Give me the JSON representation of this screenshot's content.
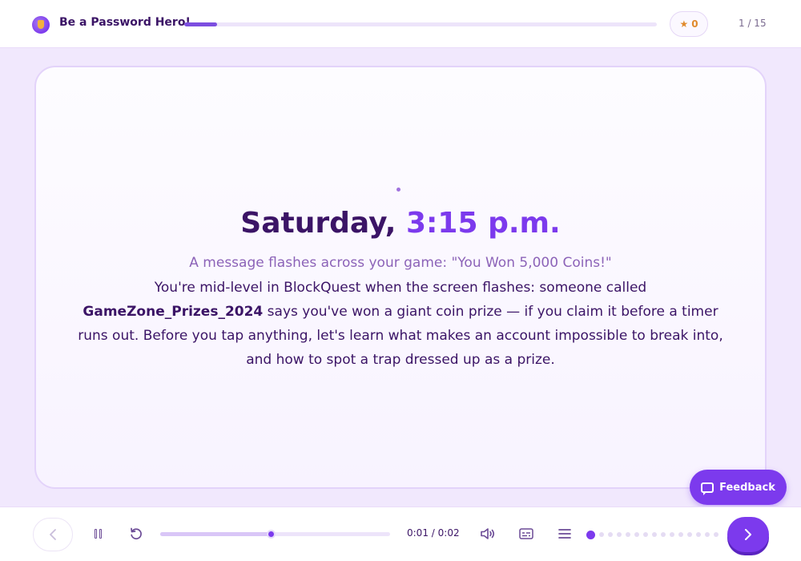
{
  "header": {
    "app_title": "Be a Password Hero!",
    "progress_fraction": 0.07,
    "star_count": "0",
    "page_counter": "1 / 15"
  },
  "scene": {
    "title_day": "Saturday,",
    "title_time_num": "3:15",
    "title_time_ampm": "p.m.",
    "subtitle": "A message flashes across your game: \"You Won 5,000 Coins!\"",
    "body_part1": "You're mid-level in BlockQuest when the screen flashes: someone called ",
    "body_bold": "GameZone_Prizes_2024",
    "body_part2": " says you've won a giant coin prize — if you claim it before a timer runs out. Before you tap anything, let's learn what makes an account impossible to break into, and how to spot a trap dressed up as a prize."
  },
  "feedback": {
    "label": "Feedback"
  },
  "player": {
    "current_time": "0:01",
    "separator": "/",
    "duration": "0:02",
    "seek_fraction": 0.48,
    "slide_dots_total": 15,
    "slide_dots_active": 0
  },
  "colors": {
    "accent": "#7c3aed",
    "title_dark": "#3b1466",
    "star": "#e08a2b",
    "background": "#f1e8fd"
  },
  "icons": {
    "logo": "shield-logo-icon",
    "star": "star-icon",
    "feedback": "chat-bubble-icon",
    "prev": "chevron-left-icon",
    "pause": "pause-icon",
    "replay": "replay-icon",
    "volume": "volume-icon",
    "captions": "captions-icon",
    "menu": "menu-icon",
    "next": "chevron-right-icon"
  }
}
